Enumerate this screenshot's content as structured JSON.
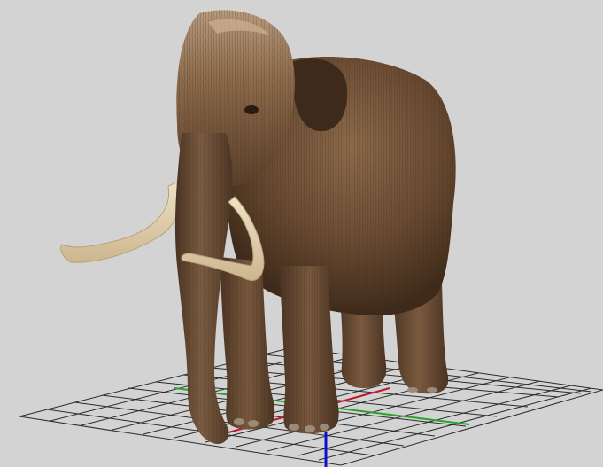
{
  "viewport": {
    "background": "#d3d3d3",
    "subject": "woolly-mammoth-3d-model"
  },
  "grid": {
    "line_color": "#2b2b2b",
    "visible": true
  },
  "axes": {
    "x_color": "#c0182a",
    "y_color": "#2aa12a",
    "z_color": "#1010d0"
  },
  "model": {
    "fur_dark": "#3e2a1a",
    "fur_mid": "#6b4c33",
    "fur_light": "#8c6a4b",
    "fur_highlight": "#b89a7c",
    "tusk": "#e4d2ae"
  }
}
